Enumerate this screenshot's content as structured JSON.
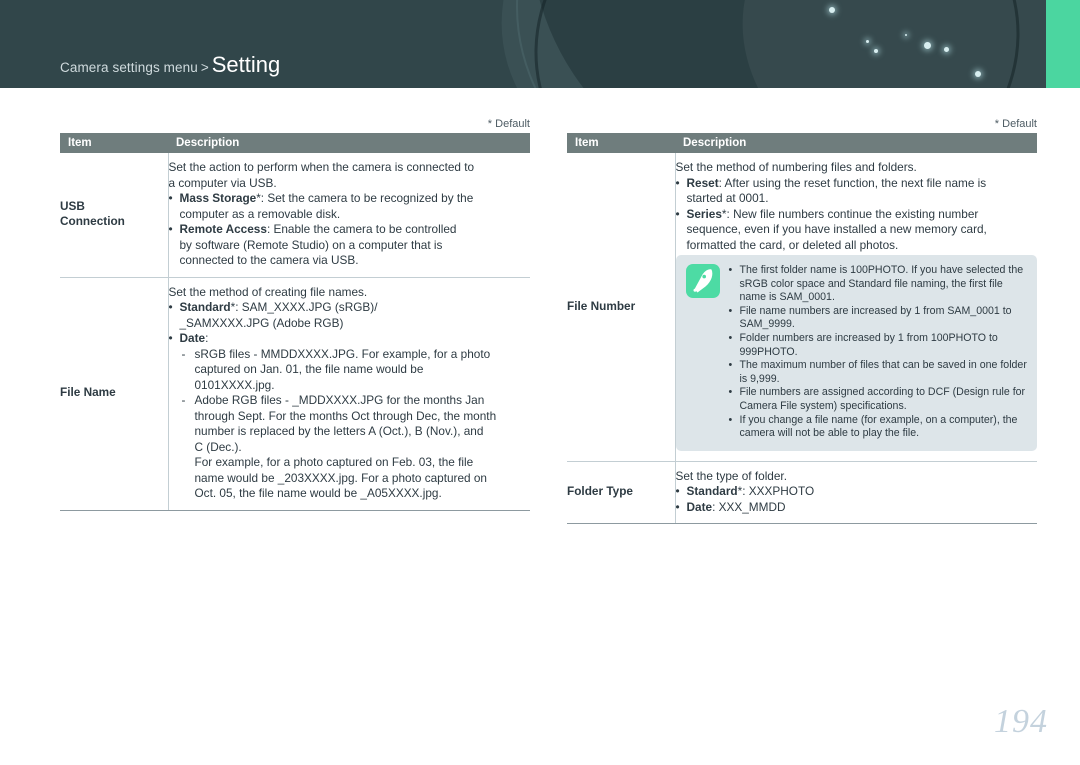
{
  "header": {
    "breadcrumb_prefix": "Camera settings menu",
    "breadcrumb_separator": ">",
    "title": "Setting",
    "accent_color": "#4bd6a0",
    "background_color": "#31464a"
  },
  "left_column": {
    "default_note": "* Default",
    "columns": {
      "item": "Item",
      "description": "Description"
    },
    "rows": [
      {
        "item": "USB Connection",
        "item_line1": "USB",
        "item_line2": "Connection",
        "lines": [
          {
            "type": "text",
            "text": "Set the action to perform when the camera is connected to"
          },
          {
            "type": "text",
            "text": "a computer via USB."
          },
          {
            "type": "bullet",
            "bold": "Mass Storage",
            "rest": "*: Set the camera to be recognized by the"
          },
          {
            "type": "text_indent",
            "text": "computer as a removable disk."
          },
          {
            "type": "bullet",
            "bold": "Remote Access",
            "rest": ": Enable the camera to be controlled"
          },
          {
            "type": "text_indent",
            "text": "by software (Remote Studio) on a computer that is"
          },
          {
            "type": "text_indent",
            "text": "connected to the camera via USB."
          }
        ]
      },
      {
        "item": "File Name",
        "lines": [
          {
            "type": "text",
            "text": "Set the method of creating file names."
          },
          {
            "type": "bullet",
            "bold": "Standard",
            "rest": "*: SAM_XXXX.JPG (sRGB)/"
          },
          {
            "type": "text_indent",
            "text": "_SAMXXXX.JPG (Adobe RGB)"
          },
          {
            "type": "bullet",
            "bold": "Date",
            "rest": ":"
          },
          {
            "type": "dash",
            "text": "sRGB files - MMDDXXXX.JPG. For example, for a photo"
          },
          {
            "type": "dash_cont",
            "text": "captured on Jan. 01, the file name would be"
          },
          {
            "type": "dash_cont",
            "text": "0101XXXX.jpg."
          },
          {
            "type": "dash",
            "text": "Adobe RGB files - _MDDXXXX.JPG for the months Jan"
          },
          {
            "type": "dash_cont",
            "text": "through Sept. For the months Oct through Dec, the month"
          },
          {
            "type": "dash_cont",
            "text": "number is replaced by the letters A (Oct.), B (Nov.), and"
          },
          {
            "type": "dash_cont",
            "text": "C (Dec.)."
          },
          {
            "type": "dash_cont",
            "text": "For example, for a photo captured on Feb. 03, the file"
          },
          {
            "type": "dash_cont",
            "text": "name would be _203XXXX.jpg. For a photo captured on"
          },
          {
            "type": "dash_cont",
            "text": "Oct. 05, the file name would be _A05XXXX.jpg."
          }
        ]
      }
    ]
  },
  "right_column": {
    "default_note": "* Default",
    "columns": {
      "item": "Item",
      "description": "Description"
    },
    "rows": [
      {
        "item": "File Number",
        "lines": [
          {
            "type": "text",
            "text": "Set the method of numbering files and folders."
          },
          {
            "type": "bullet",
            "bold": "Reset",
            "rest": ": After using the reset function, the next file name is"
          },
          {
            "type": "text_indent",
            "text": "started at 0001."
          },
          {
            "type": "bullet",
            "bold": "Series",
            "rest": "*: New file numbers continue the existing number"
          },
          {
            "type": "text_indent",
            "text": "sequence, even if you have installed a new memory card,"
          },
          {
            "type": "text_indent",
            "text": "formatted the card, or deleted all photos."
          }
        ],
        "note": {
          "icon": "pen-note-icon",
          "background_color": "#dde5e9",
          "icon_color": "#4ddba4",
          "items": [
            "The first folder name is 100PHOTO. If you have selected the sRGB color space and Standard file naming, the first file name is SAM_0001.",
            "File name numbers are increased by 1 from SAM_0001 to SAM_9999.",
            "Folder numbers are increased by 1 from 100PHOTO to 999PHOTO.",
            "The maximum number of files that can be saved in one folder is 9,999.",
            "File numbers are assigned according to DCF (Design rule for Camera File system) specifications.",
            "If you change a file name (for example, on a computer), the camera will not be able to play the file."
          ]
        }
      },
      {
        "item": "Folder Type",
        "lines": [
          {
            "type": "text",
            "text": "Set the type of folder."
          },
          {
            "type": "bullet",
            "bold": "Standard",
            "rest": "*: XXXPHOTO"
          },
          {
            "type": "bullet",
            "bold": "Date",
            "rest": ": XXX_MMDD"
          }
        ]
      }
    ]
  },
  "footer": {
    "page_number": "194"
  }
}
